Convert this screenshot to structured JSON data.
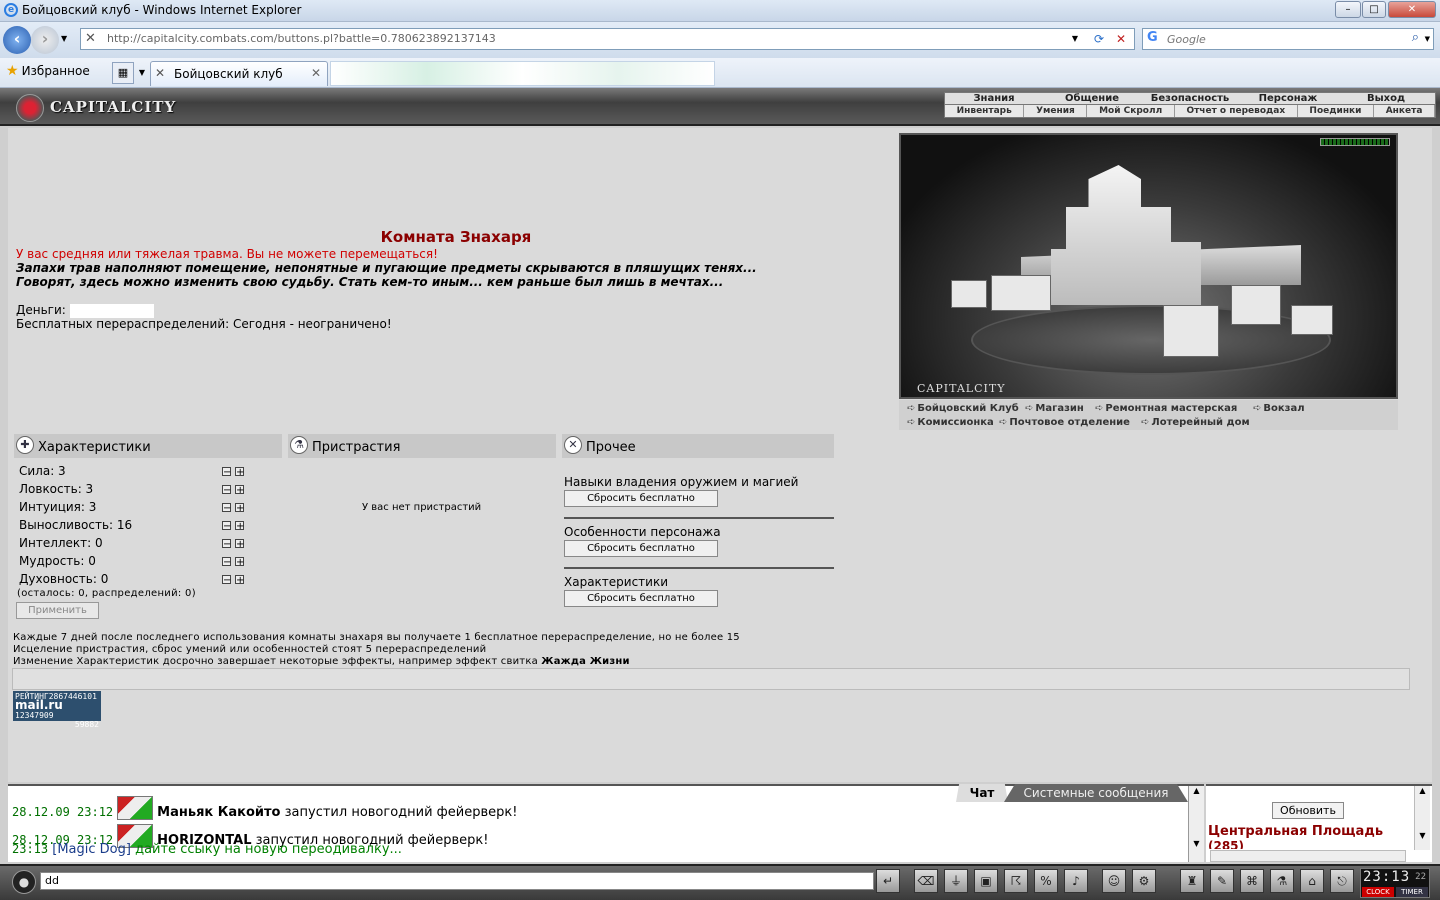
{
  "window": {
    "title": "Бойцовский клуб - Windows Internet Explorer",
    "min": "–",
    "max": "□",
    "close": "✕"
  },
  "nav": {
    "url": "http://capitalcity.combats.com/buttons.pl?battle=0.780623892137143",
    "search_placeholder": "Google"
  },
  "favbar": {
    "favorites": "Избранное",
    "tab_label": "Бойцовский клуб"
  },
  "game": {
    "logo": "CAPITALCITY",
    "menu_top": [
      "Знания",
      "Общение",
      "Безопасность",
      "Персонаж",
      "Выход"
    ],
    "menu_bottom": [
      "Инвентарь",
      "Умения",
      "Мой Скролл",
      "Отчет о переводах",
      "Поединки",
      "Анкета"
    ],
    "room_title": "Комната Знахаря",
    "warning": "У вас средняя или тяжелая травма. Вы не можете перемещаться!",
    "flavor1": "Запахи трав наполняют помещение, непонятные и пугающие предметы скрываются в пляшущих тенях...",
    "flavor2": "Говорят, здесь можно изменить свою судьбу. Стать кем-то иным... кем раньше был лишь в мечтах...",
    "money_label": "Деньги:",
    "free_redistrib": "Бесплатных перераспределений: Сегодня - неограничено!",
    "sections": {
      "stats": "Характеристики",
      "addictions": "Пристрастия",
      "other": "Прочее"
    },
    "stats": [
      "Сила: 3",
      "Ловкость: 3",
      "Интуиция: 3",
      "Выносливость: 16",
      "Интеллект: 0",
      "Мудрость: 0",
      "Духовность: 0"
    ],
    "remaining": "(осталось: 0, распределений: 0)",
    "apply": "Применить",
    "no_addictions": "У вас нет пристрастий",
    "other_items": [
      {
        "label": "Навыки владения оружием и магией",
        "button": "Сбросить бесплатно"
      },
      {
        "label": "Особенности персонажа",
        "button": "Сбросить бесплатно"
      },
      {
        "label": "Характеристики",
        "button": "Сбросить бесплатно"
      }
    ],
    "notes": [
      "Каждые 7 дней после последнего использования комнаты знахаря вы получаете 1 бесплатное перераспределение, но не более 15",
      "Исцеление пристрастия, сброс умений или особенностей стоят 5 перераспределений",
      "Изменение Характеристик досрочно завершает некоторые эффекты, например эффект свитка "
    ],
    "note_bold": "Жажда Жизни",
    "counter": {
      "line1": "РЕЙТИНГ2867446101",
      "brand": "mail.ru",
      "line2": "12347909",
      "line3": "59882"
    },
    "city_caption": "CAPITALCITY",
    "city_links": [
      "Бойцовский Клуб",
      "Магазин",
      "Ремонтная мастерская",
      "Вокзал",
      "Комиссионка",
      "Почтовое отделение",
      "Лотерейный дом"
    ]
  },
  "chat": {
    "tabs": [
      "Чат",
      "Системные сообщения"
    ],
    "rows": [
      {
        "time": "28.12.09 23:12",
        "name": "Маньяк Какойто",
        "text": " запустил новогодний фейерверк!"
      },
      {
        "time": "28.12.09 23:12",
        "name": "HORIZONTAL",
        "text": " запустил новогодний фейерверк!"
      },
      {
        "time": "23:13",
        "name": "[Magic Dog]",
        "text": " дайте ссыку на новую переодивалку..."
      }
    ],
    "input": "dd"
  },
  "side": {
    "refresh": "Обновить",
    "location": "Центральная Площадь",
    "location_sub": "(285)"
  },
  "clock": {
    "time": "23:13",
    "sec": "22",
    "clock_label": "CLOCK",
    "timer_label": "TIMER"
  }
}
